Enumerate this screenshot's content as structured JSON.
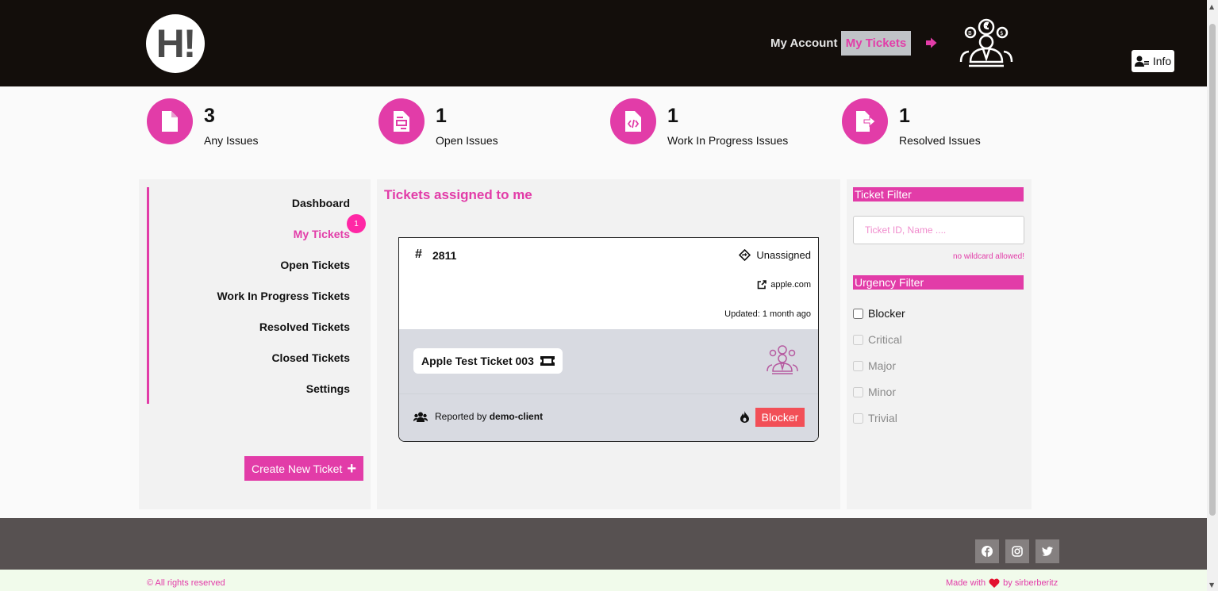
{
  "header": {
    "logo_text": "H!",
    "nav": {
      "account_label": "My Account",
      "tickets_label": "My Tickets"
    },
    "info_label": "Info"
  },
  "stats": [
    {
      "value": "3",
      "label": "Any Issues",
      "icon": "file-icon"
    },
    {
      "value": "1",
      "label": "Open Issues",
      "icon": "document-icon"
    },
    {
      "value": "1",
      "label": "Work In Progress Issues",
      "icon": "code-file-icon"
    },
    {
      "value": "1",
      "label": "Resolved Issues",
      "icon": "file-export-icon"
    }
  ],
  "sidebar": {
    "items": [
      {
        "label": "Dashboard"
      },
      {
        "label": "My Tickets",
        "active": true,
        "badge": "1"
      },
      {
        "label": "Open Tickets"
      },
      {
        "label": "Work In Progress Tickets"
      },
      {
        "label": "Resolved Tickets"
      },
      {
        "label": "Closed Tickets"
      },
      {
        "label": "Settings"
      }
    ],
    "create_button_label": "Create New Ticket"
  },
  "main": {
    "title": "Tickets assigned to me",
    "ticket": {
      "hash": "#",
      "id": "2811",
      "assignee": "Unassigned",
      "domain": "apple.com",
      "updated": "Updated: 1 month ago",
      "name": "Apple Test Ticket 003",
      "reported_by_prefix": "Reported by",
      "reporter": "demo-client",
      "urgency": "Blocker"
    }
  },
  "filters": {
    "ticket_filter_title": "Ticket Filter",
    "search_placeholder": "Ticket ID, Name ....",
    "search_hint": "no wildcard allowed!",
    "urgency_title": "Urgency Filter",
    "urgency_options": [
      {
        "label": "Blocker",
        "enabled": true
      },
      {
        "label": "Critical",
        "enabled": false
      },
      {
        "label": "Major",
        "enabled": false
      },
      {
        "label": "Minor",
        "enabled": false
      },
      {
        "label": "Trivial",
        "enabled": false
      }
    ]
  },
  "footer": {
    "social": [
      "facebook-icon",
      "instagram-icon",
      "twitter-icon"
    ],
    "copyright": "© All rights reserved",
    "made_with_prefix": "Made with",
    "made_with_suffix": "by sirberberitz"
  },
  "colors": {
    "accent": "#e23ca8",
    "header_bg": "#130e0b",
    "footer_bg": "#575151",
    "blocker": "#f24f57"
  }
}
